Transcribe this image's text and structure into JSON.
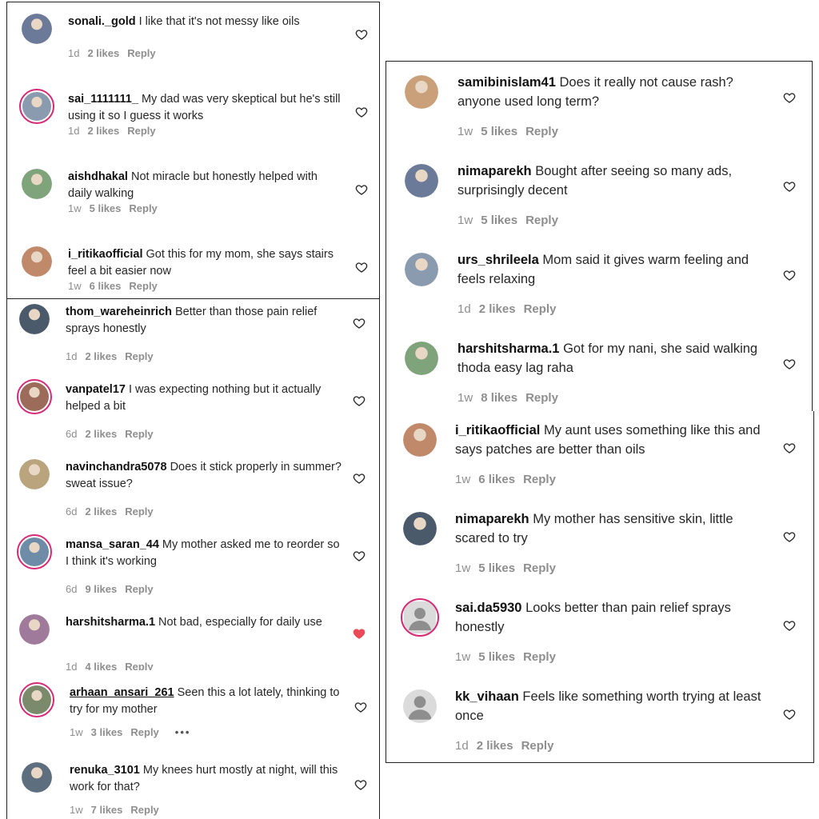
{
  "reply_label": "Reply",
  "more_dots": "•••",
  "colors": {
    "heart_liked": "#ed4956",
    "ring": "#d62976",
    "meta_gray": "#8e8e8e"
  },
  "panel1": [
    {
      "user": "sonali._gold",
      "text": "I like that it's not messy like oils",
      "time": "1d",
      "likes": "2 likes",
      "ring": false,
      "liked": false
    },
    {
      "user": "sai_1111111_",
      "text": "My dad was very skeptical but he's still using it so I guess it works",
      "time": "1d",
      "likes": "2 likes",
      "ring": true,
      "liked": false
    },
    {
      "user": "aishdhakal",
      "text": "Not miracle but honestly helped with daily walking",
      "time": "1w",
      "likes": "5 likes",
      "ring": false,
      "liked": false
    },
    {
      "user": "i_ritikaofficial",
      "text": "Got this for my mom, she says stairs feel a bit easier now",
      "time": "1w",
      "likes": "6 likes",
      "ring": false,
      "liked": false
    }
  ],
  "panel2": [
    {
      "user": "thom_wareheinrich",
      "text": "Better than those pain relief sprays honestly",
      "time": "1d",
      "likes": "2 likes",
      "ring": false,
      "liked": false
    },
    {
      "user": "vanpatel17",
      "text": "I was expecting nothing but it actually helped a bit",
      "time": "6d",
      "likes": "2 likes",
      "ring": true,
      "liked": false
    },
    {
      "user": "navinchandra5078",
      "text": "Does it stick properly in summer? sweat issue?",
      "time": "6d",
      "likes": "2 likes",
      "ring": false,
      "liked": false
    },
    {
      "user": "mansa_saran_44",
      "text": "My mother asked me to reorder so I think it's working",
      "time": "6d",
      "likes": "9 likes",
      "ring": true,
      "liked": false
    },
    {
      "user": "harshitsharma.1",
      "text": "Not bad, especially for daily use",
      "time": "1d",
      "likes": "4 likes",
      "ring": false,
      "liked": true
    }
  ],
  "panel3": [
    {
      "user": "arhaan_ansari_261",
      "text": "Seen this a lot lately, thinking to try for my mother",
      "time": "1w",
      "likes": "3 likes",
      "ring": true,
      "liked": false
    },
    {
      "user": "renuka_3101",
      "text": "My knees hurt mostly at night, will this work for that?",
      "time": "1w",
      "likes": "7 likes",
      "ring": false,
      "liked": false
    }
  ],
  "panel4": [
    {
      "user": "samibinislam41",
      "text": "Does it really not cause rash? anyone used long term?",
      "time": "1w",
      "likes": "5 likes",
      "ring": false,
      "liked": false
    },
    {
      "user": "nimaparekh",
      "text": "Bought after seeing so many ads, surprisingly decent",
      "time": "1w",
      "likes": "5 likes",
      "ring": false,
      "liked": false
    },
    {
      "user": "urs_shrileela",
      "text": "Mom said it gives warm feeling and feels relaxing",
      "time": "1d",
      "likes": "2 likes",
      "ring": false,
      "liked": false
    },
    {
      "user": "harshitsharma.1",
      "text": "Got for my nani, she said walking thoda easy lag raha",
      "time": "1w",
      "likes": "8 likes",
      "ring": false,
      "liked": false
    }
  ],
  "panel5": [
    {
      "user": "i_ritikaofficial",
      "text": "My aunt uses something like this and says patches are better than oils",
      "time": "1w",
      "likes": "6 likes",
      "ring": false,
      "liked": false
    },
    {
      "user": "nimaparekh",
      "text": "My mother has sensitive skin, little scared to try",
      "time": "1w",
      "likes": "5 likes",
      "ring": false,
      "liked": false
    },
    {
      "user": "sai.da5930",
      "text": "Looks better than pain relief sprays honestly",
      "time": "1w",
      "likes": "5 likes",
      "ring": true,
      "liked": false
    },
    {
      "user": "kk_vihaan",
      "text": "Feels like something worth trying at least once",
      "time": "1d",
      "likes": "2 likes",
      "ring": false,
      "liked": false
    }
  ]
}
